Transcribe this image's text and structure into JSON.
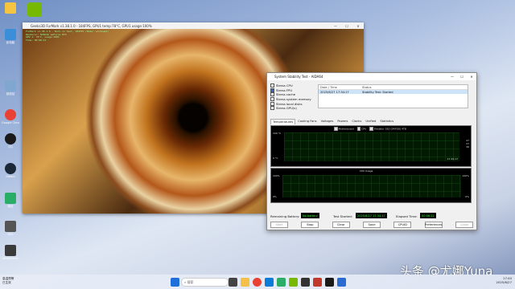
{
  "desktop": {
    "icons": [
      {
        "label": "",
        "color": "#f5c542"
      },
      {
        "label": "此电脑",
        "color": "#3a8fd8"
      },
      {
        "label": "回收站",
        "color": "#7fa7cf"
      },
      {
        "label": "Google Chrome",
        "color": "#e94235"
      },
      {
        "label": "QQ",
        "color": "#1a1a1a"
      },
      {
        "label": "Steam",
        "color": "#1b2838"
      },
      {
        "label": "微信",
        "color": "#2aae67"
      },
      {
        "label": "NVS",
        "color": "#555"
      },
      {
        "label": "Afterburner",
        "color": "#3a3a3a"
      }
    ],
    "pinned": [
      {
        "name": "nvidia-icon",
        "color": "#76b900"
      }
    ]
  },
  "furmark": {
    "title": "Geeks3D FurMark v1.38.1.0 - 184FPS, GPU1 temp:78°C, GPU1 usage:100%",
    "osd": "FurMark v1.38.1.0 - Burn-in test, 184FPS (Mode: windowed)\nRenderer: NVIDIA GeForce RTX\nGPU 1: 78°C, usage:100%\nTime: 00:06:21"
  },
  "aida": {
    "title": "System Stability Test - AIDA64",
    "checks": [
      {
        "label": "Stress CPU",
        "on": false
      },
      {
        "label": "Stress FPU",
        "on": true
      },
      {
        "label": "Stress cache",
        "on": false
      },
      {
        "label": "Stress system memory",
        "on": false
      },
      {
        "label": "Stress local disks",
        "on": false
      },
      {
        "label": "Stress GPU(s)",
        "on": false
      }
    ],
    "log_headers": [
      "Date / Time",
      "Status"
    ],
    "log_row": [
      "2025/6/27 17:34:17",
      "Stability Test: Started"
    ],
    "tabs": [
      "Temperatures",
      "Cooling Fans",
      "Voltages",
      "Powers",
      "Clocks",
      "Unified",
      "Statistics"
    ],
    "temp_legend": [
      "Motherboard",
      "CPU",
      "Predator SSD GM7000 4TB"
    ],
    "temp_axis_top": "100 °C",
    "temp_axis_bottom": "0 °C",
    "temp_values": [
      "47",
      "37",
      "36"
    ],
    "temp_time": "17:34:17",
    "cpu_title": "CPU Usage",
    "cpu_top_left": "100%",
    "cpu_top_right": "100%",
    "cpu_bottom_left": "0%",
    "cpu_bottom_right": "0%",
    "battery_label": "Remaining Battery:",
    "battery_value": "No battery",
    "started_label": "Test Started:",
    "started_value": "2025/6/27 17:34:17",
    "elapsed_label": "Elapsed Time:",
    "elapsed_value": "00:06:22",
    "buttons": [
      "Start",
      "Stop",
      "Clear",
      "Save",
      "CPUID",
      "Preferences",
      "Close"
    ]
  },
  "taskbar": {
    "weather_line1": "高温预警",
    "weather_line2": "已生效",
    "search_placeholder": "搜索",
    "time": "17:40",
    "date": "2025/6/27"
  },
  "watermark": "头条 @尤娜Yuna"
}
